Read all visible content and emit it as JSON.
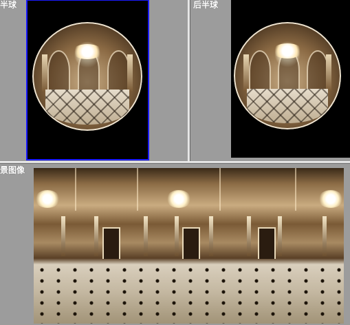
{
  "panels": {
    "front": {
      "label": "半球",
      "selected": true
    },
    "back": {
      "label": "后半球",
      "selected": false
    },
    "pano": {
      "label": "景图像"
    }
  },
  "colors": {
    "background": "#9c9c9c",
    "selection": "#1a1aff",
    "viewport": "#000000",
    "label_text": "#ffffff"
  },
  "icons": [
    "fisheye-image",
    "panorama-image"
  ]
}
